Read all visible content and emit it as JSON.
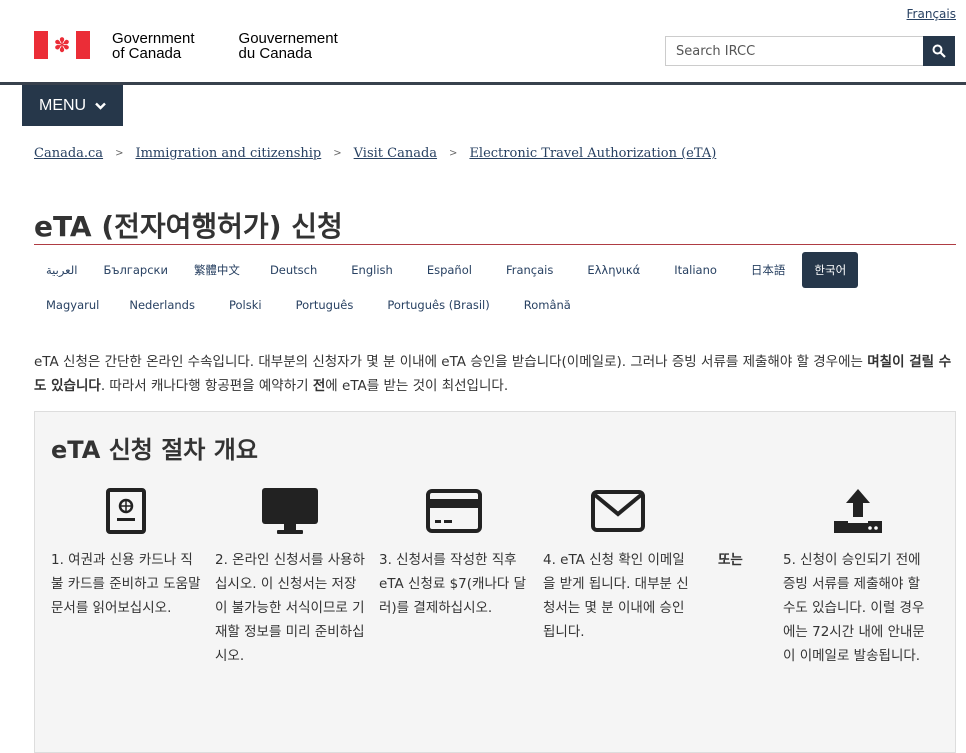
{
  "header": {
    "language_toggle": "Français",
    "gov_en_line1": "Government",
    "gov_en_line2": "of Canada",
    "gov_fr_line1": "Gouvernement",
    "gov_fr_line2": "du Canada",
    "search_placeholder": "Search IRCC",
    "search_icon": "search-icon",
    "menu_label": "MENU",
    "menu_icon": "chevron-down-icon",
    "colors": {
      "accent": "#26374a",
      "flag_red": "#eb2d37",
      "link": "#284162",
      "title_rule": "#af3c43"
    }
  },
  "breadcrumb": [
    "Canada.ca",
    "Immigration and citizenship",
    "Visit Canada",
    "Electronic Travel Authorization (eTA)"
  ],
  "page_title": "eTA (전자여행허가) 신청",
  "languages": {
    "row1": [
      "العربية",
      "Български",
      "繁體中文",
      "Deutsch",
      "English",
      "Español",
      "Français",
      "Ελληνικά",
      "Italiano",
      "日本語",
      "한국어"
    ],
    "row2": [
      "Magyarul",
      "Nederlands",
      "Polski",
      "Português",
      "Português (Brasil)",
      "Română"
    ],
    "active": "한국어"
  },
  "intro": {
    "part1": "eTA 신청은 간단한 온라인 수속입니다. 대부분의 신청자가 몇 분 이내에 eTA 승인을 받습니다(이메일로). 그러나 증빙 서류를 제출해야 할 경우에는",
    "bold1": "며칠이 걸릴 수도 있습니다",
    "part2": ". 따라서 캐나다행 항공편을 예약하기 ",
    "bold2": "전",
    "part3": "에 eTA를 받는 것이 최선입니다."
  },
  "overview": {
    "title": "eTA 신청 절차 개요",
    "or_label": "또는",
    "steps": [
      {
        "icon": "passport-icon",
        "text": "1. 여권과 신용 카드나 직불 카드를 준비하고 도움말 문서를 읽어보십시오."
      },
      {
        "icon": "computer-icon",
        "text": "2. 온라인 신청서를 사용하십시오. 이 신청서는 저장이 불가능한 서식이므로 기재할 정보를 미리 준비하십시오."
      },
      {
        "icon": "credit-card-icon",
        "text": "3. 신청서를 작성한 직후 eTA 신청료 $7(캐나다 달러)를 결제하십시오."
      },
      {
        "icon": "envelope-icon",
        "text": "4. eTA 신청 확인 이메일을 받게 됩니다. 대부분 신청서는 몇 분 이내에 승인됩니다."
      },
      {
        "icon": "upload-icon",
        "text": "5. 신청이 승인되기 전에 증빙 서류를 제출해야 할 수도 있습니다. 이럴 경우에는 72시간 내에 안내문이 이메일로 발송됩니다."
      }
    ]
  }
}
